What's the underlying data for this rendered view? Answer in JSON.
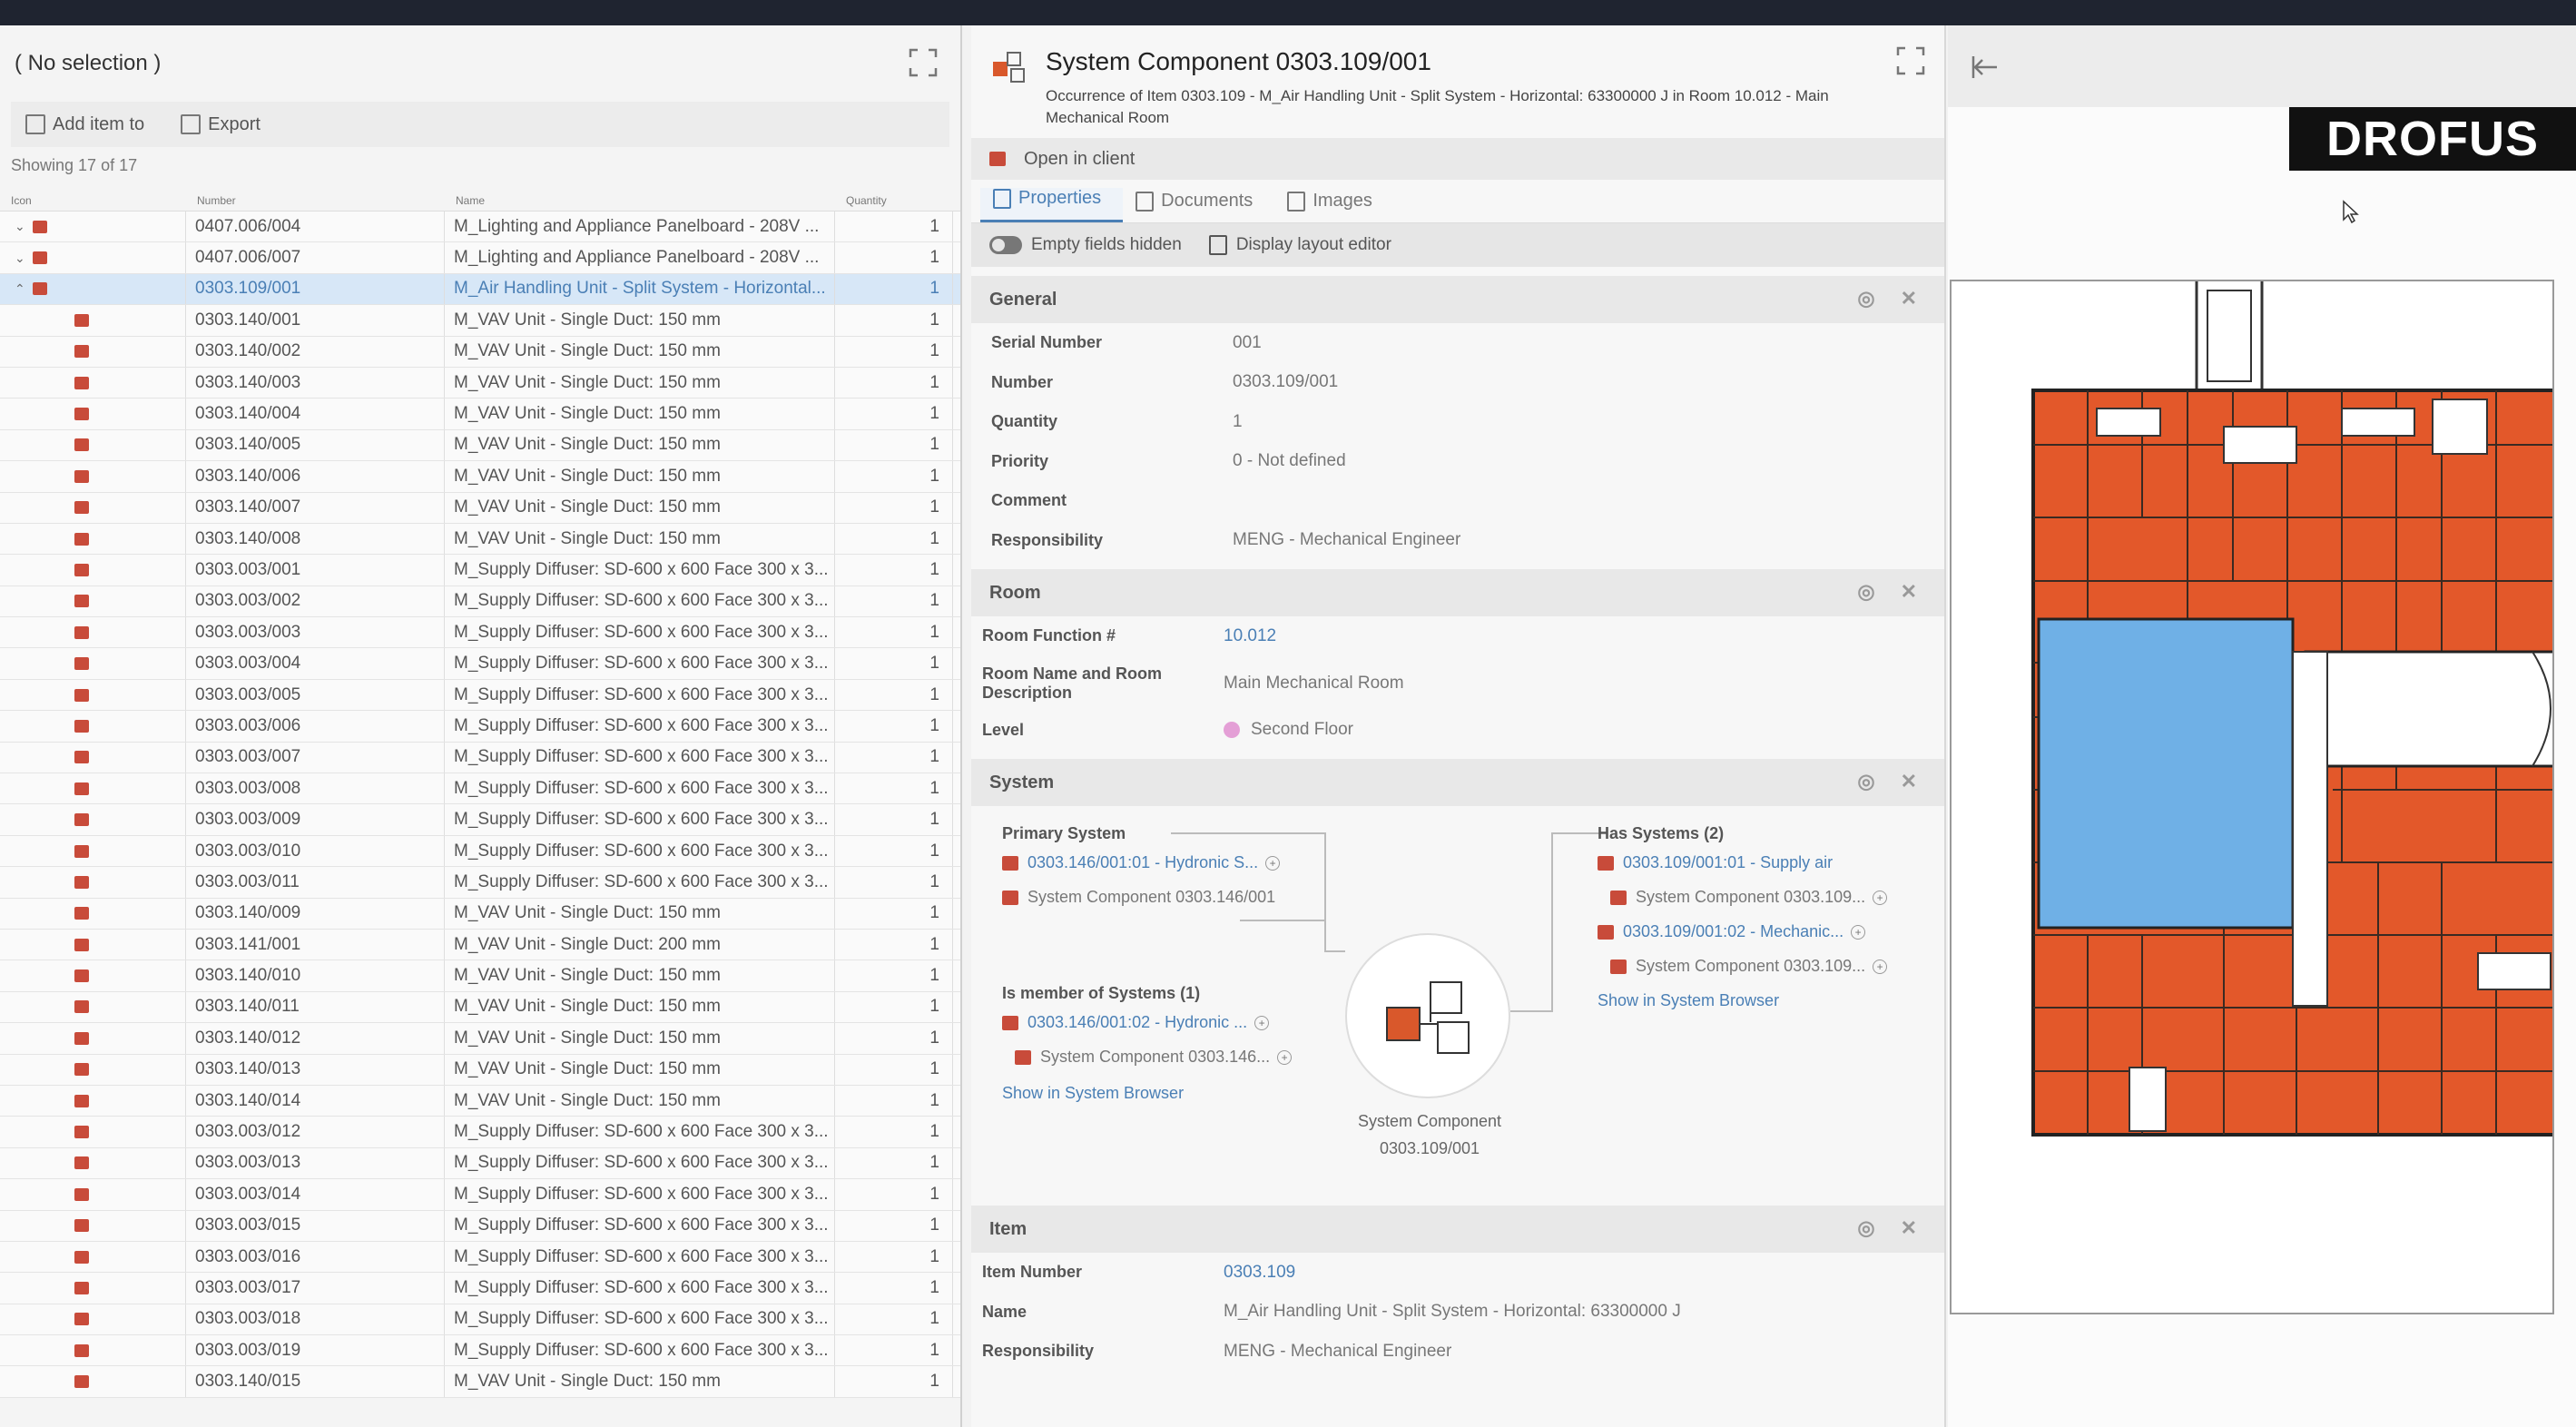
{
  "left_panel": {
    "title": "( No selection )",
    "toolbar": {
      "add_label": "Add item to",
      "export_label": "Export"
    },
    "showing": "Showing 17 of 17",
    "columns": [
      "Icon",
      "Number",
      "Name",
      "Quantity"
    ],
    "rows": [
      {
        "expand": "down",
        "number": "0407.006/004",
        "name": "M_Lighting and Appliance Panelboard - 208V ...",
        "qty": "1",
        "child": false,
        "selected": false
      },
      {
        "expand": "down",
        "number": "0407.006/007",
        "name": "M_Lighting and Appliance Panelboard - 208V ...",
        "qty": "1",
        "child": false,
        "selected": false
      },
      {
        "expand": "up",
        "number": "0303.109/001",
        "name": "M_Air Handling Unit - Split System - Horizontal...",
        "qty": "1",
        "child": false,
        "selected": true
      },
      {
        "number": "0303.140/001",
        "name": "M_VAV Unit - Single Duct: 150 mm",
        "qty": "1",
        "child": true
      },
      {
        "number": "0303.140/002",
        "name": "M_VAV Unit - Single Duct: 150 mm",
        "qty": "1",
        "child": true
      },
      {
        "number": "0303.140/003",
        "name": "M_VAV Unit - Single Duct: 150 mm",
        "qty": "1",
        "child": true
      },
      {
        "number": "0303.140/004",
        "name": "M_VAV Unit - Single Duct: 150 mm",
        "qty": "1",
        "child": true
      },
      {
        "number": "0303.140/005",
        "name": "M_VAV Unit - Single Duct: 150 mm",
        "qty": "1",
        "child": true
      },
      {
        "number": "0303.140/006",
        "name": "M_VAV Unit - Single Duct: 150 mm",
        "qty": "1",
        "child": true
      },
      {
        "number": "0303.140/007",
        "name": "M_VAV Unit - Single Duct: 150 mm",
        "qty": "1",
        "child": true
      },
      {
        "number": "0303.140/008",
        "name": "M_VAV Unit - Single Duct: 150 mm",
        "qty": "1",
        "child": true
      },
      {
        "number": "0303.003/001",
        "name": "M_Supply Diffuser: SD-600 x 600 Face 300 x 3...",
        "qty": "1",
        "child": true
      },
      {
        "number": "0303.003/002",
        "name": "M_Supply Diffuser: SD-600 x 600 Face 300 x 3...",
        "qty": "1",
        "child": true
      },
      {
        "number": "0303.003/003",
        "name": "M_Supply Diffuser: SD-600 x 600 Face 300 x 3...",
        "qty": "1",
        "child": true
      },
      {
        "number": "0303.003/004",
        "name": "M_Supply Diffuser: SD-600 x 600 Face 300 x 3...",
        "qty": "1",
        "child": true
      },
      {
        "number": "0303.003/005",
        "name": "M_Supply Diffuser: SD-600 x 600 Face 300 x 3...",
        "qty": "1",
        "child": true
      },
      {
        "number": "0303.003/006",
        "name": "M_Supply Diffuser: SD-600 x 600 Face 300 x 3...",
        "qty": "1",
        "child": true
      },
      {
        "number": "0303.003/007",
        "name": "M_Supply Diffuser: SD-600 x 600 Face 300 x 3...",
        "qty": "1",
        "child": true
      },
      {
        "number": "0303.003/008",
        "name": "M_Supply Diffuser: SD-600 x 600 Face 300 x 3...",
        "qty": "1",
        "child": true
      },
      {
        "number": "0303.003/009",
        "name": "M_Supply Diffuser: SD-600 x 600 Face 300 x 3...",
        "qty": "1",
        "child": true
      },
      {
        "number": "0303.003/010",
        "name": "M_Supply Diffuser: SD-600 x 600 Face 300 x 3...",
        "qty": "1",
        "child": true
      },
      {
        "number": "0303.003/011",
        "name": "M_Supply Diffuser: SD-600 x 600 Face 300 x 3...",
        "qty": "1",
        "child": true
      },
      {
        "number": "0303.140/009",
        "name": "M_VAV Unit - Single Duct: 150 mm",
        "qty": "1",
        "child": true
      },
      {
        "number": "0303.141/001",
        "name": "M_VAV Unit - Single Duct: 200 mm",
        "qty": "1",
        "child": true
      },
      {
        "number": "0303.140/010",
        "name": "M_VAV Unit - Single Duct: 150 mm",
        "qty": "1",
        "child": true
      },
      {
        "number": "0303.140/011",
        "name": "M_VAV Unit - Single Duct: 150 mm",
        "qty": "1",
        "child": true
      },
      {
        "number": "0303.140/012",
        "name": "M_VAV Unit - Single Duct: 150 mm",
        "qty": "1",
        "child": true
      },
      {
        "number": "0303.140/013",
        "name": "M_VAV Unit - Single Duct: 150 mm",
        "qty": "1",
        "child": true
      },
      {
        "number": "0303.140/014",
        "name": "M_VAV Unit - Single Duct: 150 mm",
        "qty": "1",
        "child": true
      },
      {
        "number": "0303.003/012",
        "name": "M_Supply Diffuser: SD-600 x 600 Face 300 x 3...",
        "qty": "1",
        "child": true
      },
      {
        "number": "0303.003/013",
        "name": "M_Supply Diffuser: SD-600 x 600 Face 300 x 3...",
        "qty": "1",
        "child": true
      },
      {
        "number": "0303.003/014",
        "name": "M_Supply Diffuser: SD-600 x 600 Face 300 x 3...",
        "qty": "1",
        "child": true
      },
      {
        "number": "0303.003/015",
        "name": "M_Supply Diffuser: SD-600 x 600 Face 300 x 3...",
        "qty": "1",
        "child": true
      },
      {
        "number": "0303.003/016",
        "name": "M_Supply Diffuser: SD-600 x 600 Face 300 x 3...",
        "qty": "1",
        "child": true
      },
      {
        "number": "0303.003/017",
        "name": "M_Supply Diffuser: SD-600 x 600 Face 300 x 3...",
        "qty": "1",
        "child": true
      },
      {
        "number": "0303.003/018",
        "name": "M_Supply Diffuser: SD-600 x 600 Face 300 x 3...",
        "qty": "1",
        "child": true
      },
      {
        "number": "0303.003/019",
        "name": "M_Supply Diffuser: SD-600 x 600 Face 300 x 3...",
        "qty": "1",
        "child": true
      },
      {
        "number": "0303.140/015",
        "name": "M_VAV Unit - Single Duct: 150 mm",
        "qty": "1",
        "child": true
      }
    ]
  },
  "detail": {
    "title": "System Component 0303.109/001",
    "subtitle": "Occurrence of Item 0303.109 - M_Air Handling Unit - Split System - Horizontal: 63300000 J in Room 10.012 - Main Mechanical Room",
    "open_in_client": "Open in client",
    "tabs": [
      "Properties",
      "Documents",
      "Images"
    ],
    "empty_fields": "Empty fields hidden",
    "layout_editor": "Display layout editor",
    "general": {
      "heading": "General",
      "fields": [
        {
          "label": "Serial Number",
          "value": "001"
        },
        {
          "label": "Number",
          "value": "0303.109/001"
        },
        {
          "label": "Quantity",
          "value": "1"
        },
        {
          "label": "Priority",
          "value": "0 - Not defined"
        },
        {
          "label": "Comment",
          "value": ""
        },
        {
          "label": "Responsibility",
          "value": "MENG - Mechanical Engineer"
        }
      ]
    },
    "room": {
      "heading": "Room",
      "function_label": "Room Function #",
      "function_value": "10.012",
      "name_label": "Room Name and Room Description",
      "name_value": "Main Mechanical Room",
      "level_label": "Level",
      "level_value": "Second Floor"
    },
    "system": {
      "heading": "System",
      "primary_label": "Primary System",
      "primary_link": "0303.146/001:01 - Hydronic S...",
      "primary_comp": "System Component 0303.146/001",
      "member_label": "Is member of Systems (1)",
      "member_link": "0303.146/001:02 - Hydronic ...",
      "member_comp": "System Component 0303.146...",
      "show_left": "Show in System Browser",
      "has_label": "Has Systems (2)",
      "has_link_1": "0303.109/001:01 - Supply air",
      "has_comp_1": "System Component 0303.109...",
      "has_link_2": "0303.109/001:02 - Mechanic...",
      "has_comp_2": "System Component 0303.109...",
      "show_right": "Show in System Browser",
      "center_line1": "System Component",
      "center_line2": "0303.109/001"
    },
    "item": {
      "heading": "Item",
      "number_label": "Item Number",
      "number_value": "0303.109",
      "name_label": "Name",
      "name_value": "M_Air Handling Unit - Split System - Horizontal: 63300000 J",
      "resp_label": "Responsibility",
      "resp_value": "MENG - Mechanical Engineer"
    }
  },
  "viewer": {
    "logo": "DROFUS"
  },
  "colors": {
    "accent": "#4a7fb5",
    "room_orange": "#e3582a",
    "room_blue": "#6fb0e6"
  }
}
